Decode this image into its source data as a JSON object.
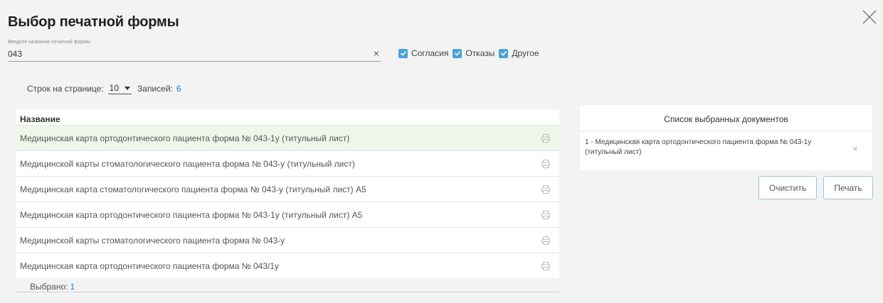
{
  "dialog": {
    "title": "Выбор печатной формы"
  },
  "search": {
    "label": "Введите название печатной формы",
    "value": "043",
    "clear_glyph": "×"
  },
  "filters": [
    {
      "label": "Согласия",
      "checked": true
    },
    {
      "label": "Отказы",
      "checked": true
    },
    {
      "label": "Другое",
      "checked": true
    }
  ],
  "pager": {
    "rows_label": "Строк на странице:",
    "rows_value": "10",
    "records_label": "Записей:",
    "records_count": "6"
  },
  "table": {
    "header": "Название",
    "rows": [
      {
        "name": "Медицинская карта ортодонтического пациента форма № 043-1у (титульный лист)",
        "selected": true
      },
      {
        "name": "Медицинской карты стоматологического пациента форма № 043-у (титульный лист)",
        "selected": false
      },
      {
        "name": "Медицинская карта стоматологического пациента форма № 043-у (титульный лист) А5",
        "selected": false
      },
      {
        "name": "Медицинская карта ортодонтического пациента форма № 043-1у (титульный лист) А5",
        "selected": false
      },
      {
        "name": "Медицинской карты стоматологического пациента форма № 043-у",
        "selected": false
      },
      {
        "name": "Медицинская карта ортодонтического пациента форма № 043/1у",
        "selected": false
      }
    ],
    "footer_label": "Выбрано:",
    "footer_count": "1"
  },
  "selected_panel": {
    "title": "Список выбранных документов",
    "items": [
      {
        "text": "1 - Медицинская карта ортодонтического пациента форма № 043-1у (титульный лист)"
      }
    ],
    "remove_glyph": "×"
  },
  "buttons": {
    "clear_label": "Очистить",
    "print_label": "Печать"
  },
  "icons": {
    "close": "close-icon",
    "print": "printer-icon",
    "check": "check-icon",
    "dropdown": "chevron-down-icon"
  },
  "colors": {
    "accent": "#4aa3d8",
    "link": "#2a7fc0",
    "selected_row": "#eef6ea",
    "button_border": "#9fc3d9"
  }
}
